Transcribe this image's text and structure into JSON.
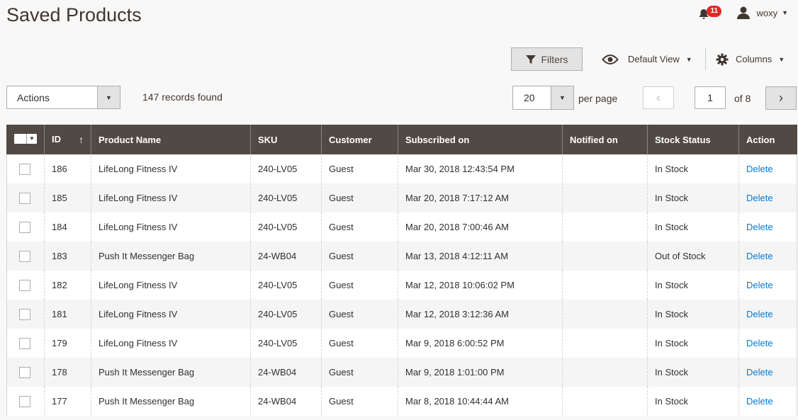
{
  "page": {
    "title": "Saved Products"
  },
  "header": {
    "notifications_count": "11",
    "user_name": "woxy"
  },
  "toolbar": {
    "filters_label": "Filters",
    "view_label": "Default View",
    "columns_label": "Columns"
  },
  "actions": {
    "label": "Actions"
  },
  "records_found": "147 records found",
  "pagination": {
    "per_page_value": "20",
    "per_page_label": "per page",
    "current_page": "1",
    "of_pages": "of 8"
  },
  "table": {
    "headers": {
      "id": "ID",
      "product_name": "Product Name",
      "sku": "SKU",
      "customer": "Customer",
      "subscribed_on": "Subscribed on",
      "notified_on": "Notified on",
      "stock_status": "Stock Status",
      "action": "Action"
    },
    "rows": [
      {
        "id": "186",
        "product_name": "LifeLong Fitness IV",
        "sku": "240-LV05",
        "customer": "Guest",
        "subscribed_on": "Mar 30, 2018 12:43:54 PM",
        "notified_on": "",
        "stock_status": "In Stock",
        "action": "Delete"
      },
      {
        "id": "185",
        "product_name": "LifeLong Fitness IV",
        "sku": "240-LV05",
        "customer": "Guest",
        "subscribed_on": "Mar 20, 2018 7:17:12 AM",
        "notified_on": "",
        "stock_status": "In Stock",
        "action": "Delete"
      },
      {
        "id": "184",
        "product_name": "LifeLong Fitness IV",
        "sku": "240-LV05",
        "customer": "Guest",
        "subscribed_on": "Mar 20, 2018 7:00:46 AM",
        "notified_on": "",
        "stock_status": "In Stock",
        "action": "Delete"
      },
      {
        "id": "183",
        "product_name": "Push It Messenger Bag",
        "sku": "24-WB04",
        "customer": "Guest",
        "subscribed_on": "Mar 13, 2018 4:12:11 AM",
        "notified_on": "",
        "stock_status": "Out of Stock",
        "action": "Delete"
      },
      {
        "id": "182",
        "product_name": "LifeLong Fitness IV",
        "sku": "240-LV05",
        "customer": "Guest",
        "subscribed_on": "Mar 12, 2018 10:06:02 PM",
        "notified_on": "",
        "stock_status": "In Stock",
        "action": "Delete"
      },
      {
        "id": "181",
        "product_name": "LifeLong Fitness IV",
        "sku": "240-LV05",
        "customer": "Guest",
        "subscribed_on": "Mar 12, 2018 3:12:36 AM",
        "notified_on": "",
        "stock_status": "In Stock",
        "action": "Delete"
      },
      {
        "id": "179",
        "product_name": "LifeLong Fitness IV",
        "sku": "240-LV05",
        "customer": "Guest",
        "subscribed_on": "Mar 9, 2018 6:00:52 PM",
        "notified_on": "",
        "stock_status": "In Stock",
        "action": "Delete"
      },
      {
        "id": "178",
        "product_name": "Push It Messenger Bag",
        "sku": "24-WB04",
        "customer": "Guest",
        "subscribed_on": "Mar 9, 2018 1:01:00 PM",
        "notified_on": "",
        "stock_status": "In Stock",
        "action": "Delete"
      },
      {
        "id": "177",
        "product_name": "Push It Messenger Bag",
        "sku": "24-WB04",
        "customer": "Guest",
        "subscribed_on": "Mar 8, 2018 10:44:44 AM",
        "notified_on": "",
        "stock_status": "In Stock",
        "action": "Delete"
      }
    ]
  },
  "colors": {
    "header_bg": "#514943",
    "link": "#007bdb",
    "badge": "#e22626"
  }
}
